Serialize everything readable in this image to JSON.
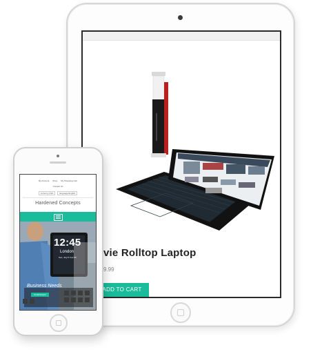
{
  "tablet": {
    "product": {
      "title": "vie Rolltop Laptop",
      "price": "9.99",
      "add_to_cart_label": "ADD TO CART"
    }
  },
  "phone": {
    "top_links": [
      "My Account",
      "Shop",
      "My Shopping Cart"
    ],
    "contact_link": "Contact Us",
    "currency_select": "currency USD",
    "language_select": "language English",
    "brand": "Hardened Concepts",
    "hero": {
      "clock": "12:45",
      "city": "London",
      "date": "Sun, July 8  Your 5h",
      "caption": "Business Needs",
      "portfolio_label": "PORTFOLIO"
    }
  },
  "colors": {
    "accent": "#1abc9c",
    "text_dark": "#222222"
  }
}
